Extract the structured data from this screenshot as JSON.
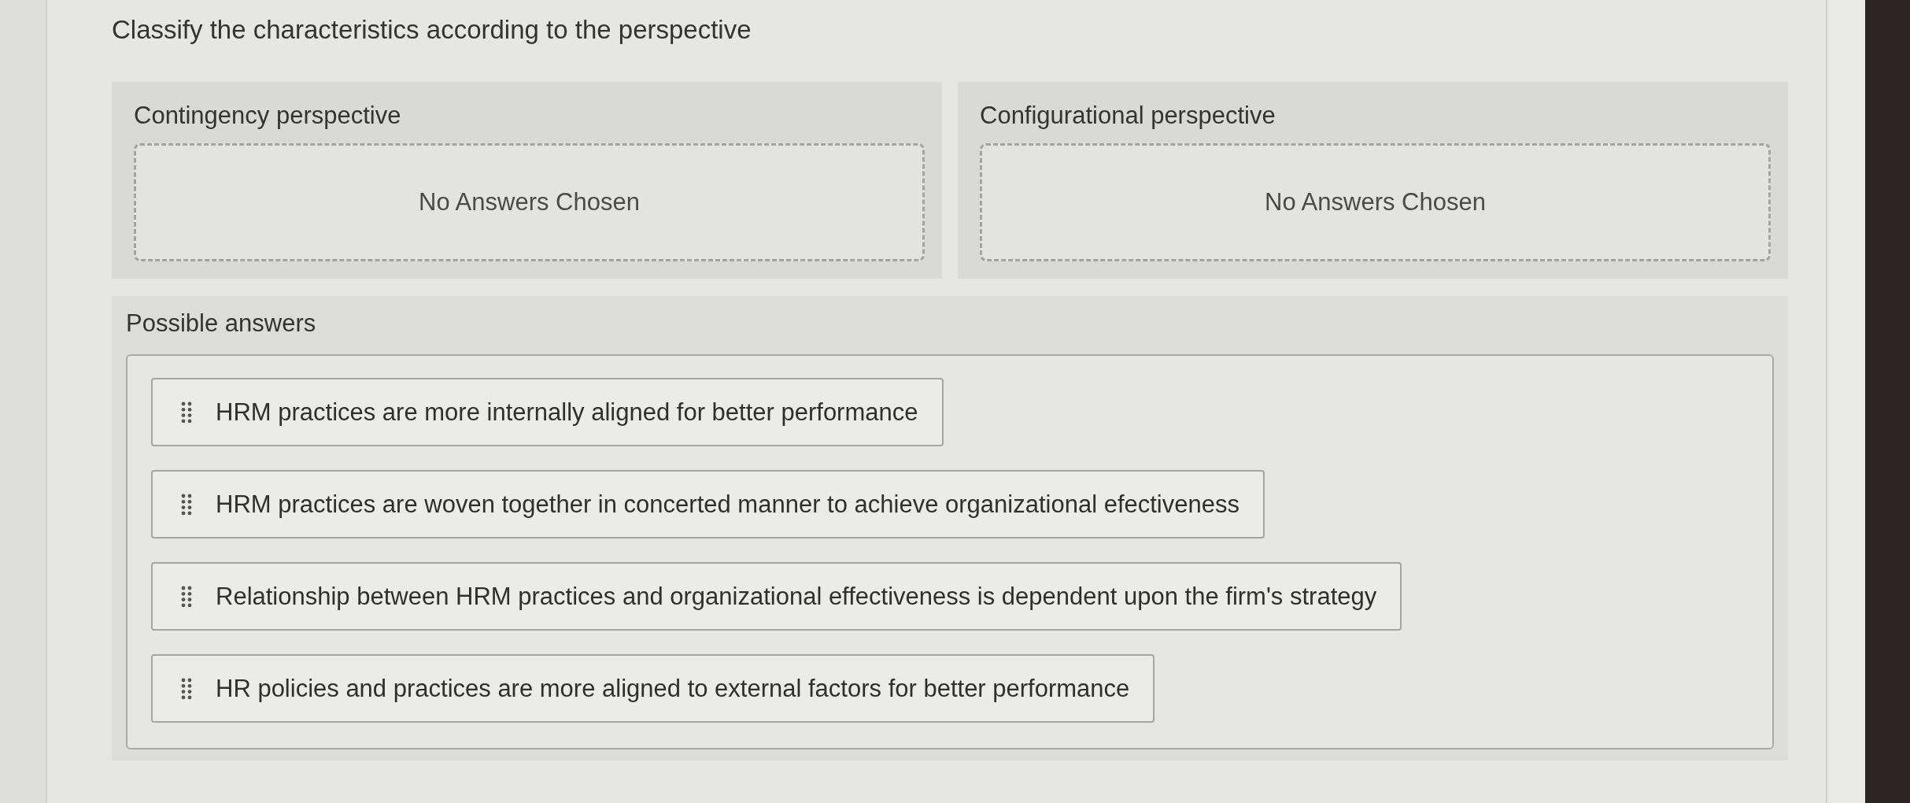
{
  "question": {
    "prompt": "Classify the characteristics according to the perspective"
  },
  "categories": [
    {
      "label": "Contingency perspective",
      "placeholder": "No Answers Chosen"
    },
    {
      "label": "Configurational perspective",
      "placeholder": "No Answers Chosen"
    }
  ],
  "answers_section": {
    "label": "Possible answers",
    "items": [
      "HRM practices are more internally aligned for better performance",
      "HRM practices are woven together in concerted manner to achieve organizational efectiveness",
      "Relationship between HRM practices and organizational effectiveness is dependent upon the firm's strategy",
      "HR policies and practices are more aligned to external factors for better performance"
    ]
  }
}
